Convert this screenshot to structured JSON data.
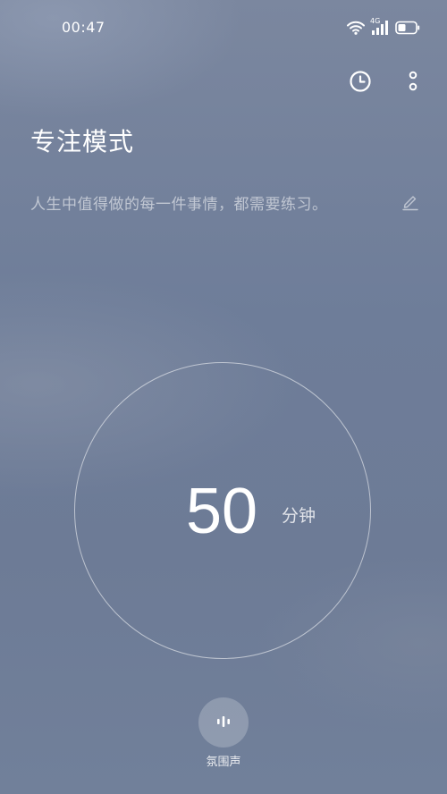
{
  "status_bar": {
    "time": "00:47",
    "network_label": "4G",
    "icons": [
      "wifi-icon",
      "signal-icon",
      "battery-icon"
    ]
  },
  "header": {
    "title": "专注模式",
    "actions": [
      "clock-icon",
      "more-vertical-icon"
    ]
  },
  "motto": {
    "text": "人生中值得做的每一件事情，都需要练习。",
    "edit_icon": "pencil-icon"
  },
  "timer": {
    "value": "50",
    "unit": "分钟"
  },
  "ambient_sound": {
    "label": "氛围声",
    "icon": "sound-wave-icon"
  },
  "colors": {
    "background": "#6e7d99",
    "text": "#ffffff",
    "muted_text": "#b6bdcb"
  }
}
